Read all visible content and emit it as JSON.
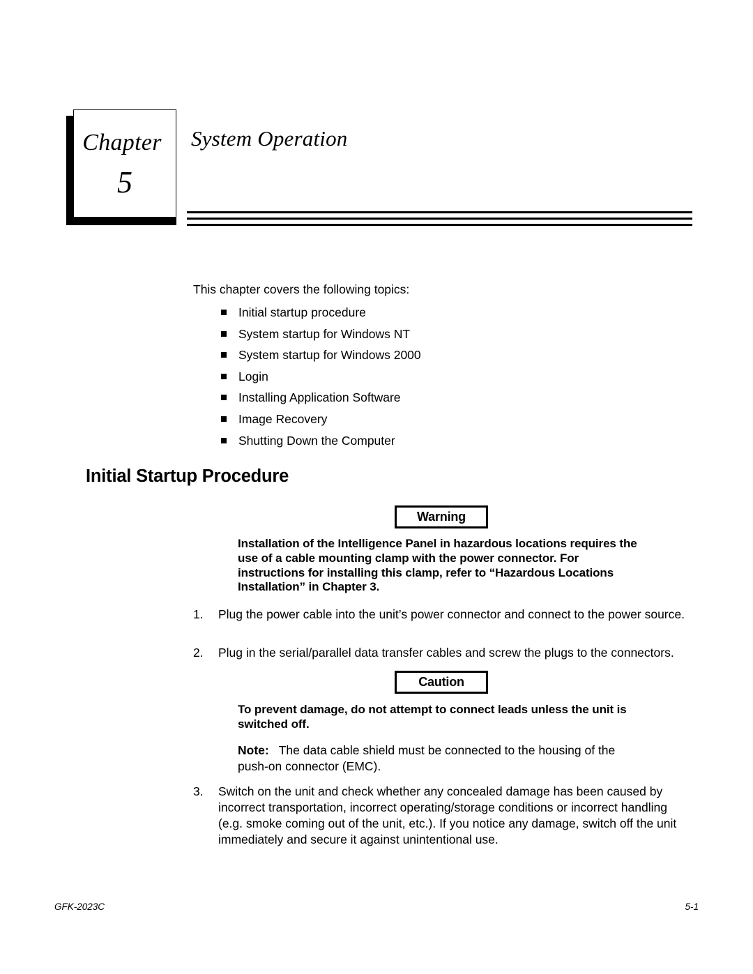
{
  "chapter": {
    "word": "Chapter",
    "number": "5",
    "title": "System Operation"
  },
  "intro": {
    "line": "This chapter covers the following topics:"
  },
  "topics": [
    {
      "label": "Initial startup procedure"
    },
    {
      "label": "System startup for Windows NT"
    },
    {
      "label": "System startup for Windows 2000"
    },
    {
      "label": "Login"
    },
    {
      "label": "Installing Application Software"
    },
    {
      "label": "Image Recovery"
    },
    {
      "label": "Shutting Down the Computer"
    }
  ],
  "section": {
    "heading": "Initial Startup Procedure"
  },
  "warning": {
    "box_label": "Warning",
    "text": "Installation of the Intelligence Panel in hazardous locations requires the use of a cable mounting clamp with the power connector. For instructions for installing this clamp, refer to “Hazardous Locations Installation” in Chapter 3."
  },
  "caution": {
    "box_label": "Caution",
    "text": "To prevent damage, do not attempt to connect leads unless the unit is switched off."
  },
  "steps": [
    {
      "number": "1.",
      "text": "Plug the power cable into the unit’s power connector and connect to the power source."
    },
    {
      "number": "2.",
      "text": "Plug in the serial/parallel data transfer cables and screw the plugs to the connectors."
    },
    {
      "number": "3.",
      "text": "Switch on the unit and check whether any concealed damage has been caused by incorrect transportation, incorrect operating/storage conditions or incorrect handling (e.g. smoke coming out of the unit, etc.). If you notice any damage, switch off the unit immediately and secure it against unintentional use."
    }
  ],
  "note": {
    "label": "Note:",
    "text": "The data cable shield must be connected to the housing of the push-on connector (EMC)."
  },
  "footer": {
    "doc_id": "GFK-2023C",
    "page_number": "5-1"
  },
  "colors": {
    "ink": "#000000",
    "paper": "#ffffff"
  }
}
